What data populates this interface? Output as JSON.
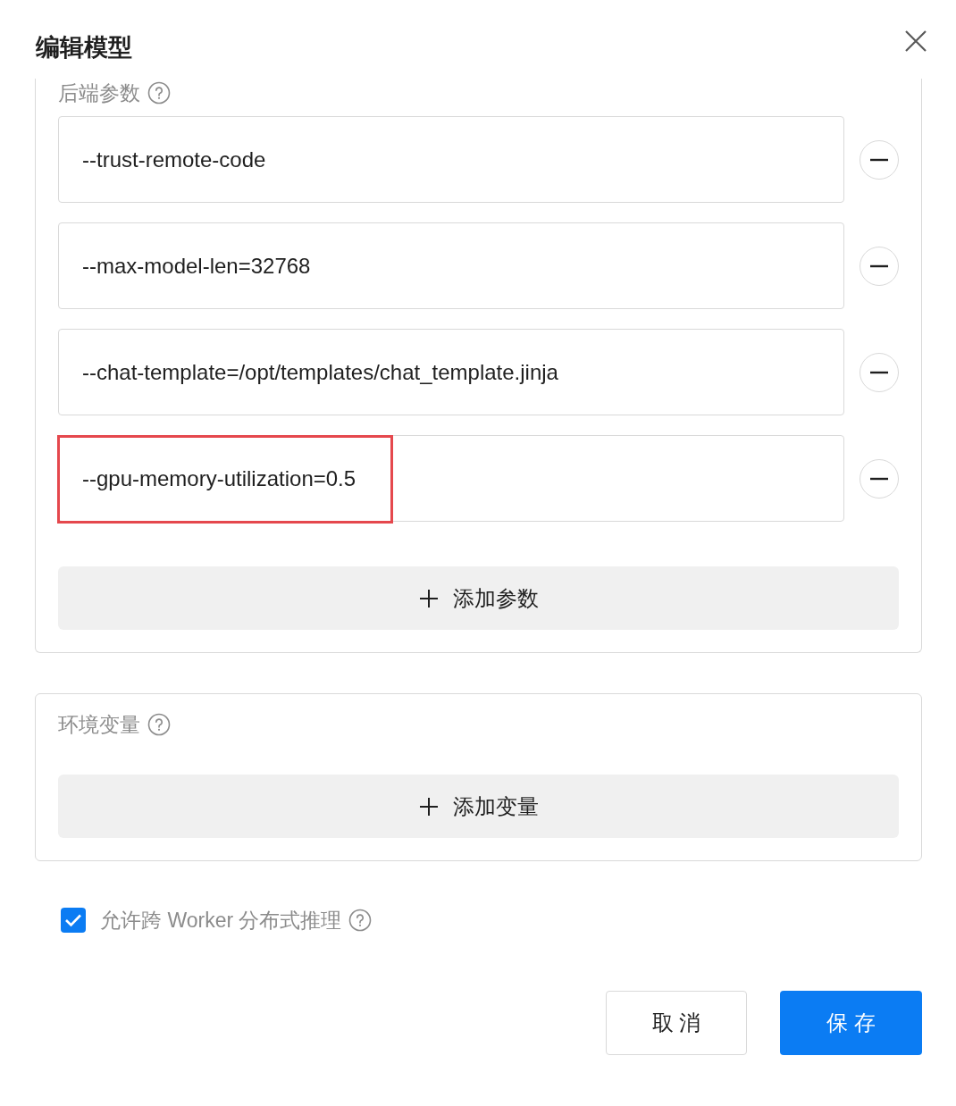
{
  "dialog": {
    "title": "编辑模型"
  },
  "backend_params": {
    "label": "后端参数",
    "params": [
      {
        "value": "--trust-remote-code",
        "highlighted": false
      },
      {
        "value": "--max-model-len=32768",
        "highlighted": false
      },
      {
        "value": "--chat-template=/opt/templates/chat_template.jinja",
        "highlighted": false
      },
      {
        "value": "--gpu-memory-utilization=0.5",
        "highlighted": true
      }
    ],
    "add_button": "添加参数"
  },
  "env_vars": {
    "label": "环境变量",
    "add_button": "添加变量"
  },
  "distributed": {
    "label": "允许跨 Worker 分布式推理",
    "checked": true
  },
  "buttons": [
    {
      "label": "取 消",
      "kind": "secondary"
    },
    {
      "label": "保 存",
      "kind": "primary"
    }
  ]
}
